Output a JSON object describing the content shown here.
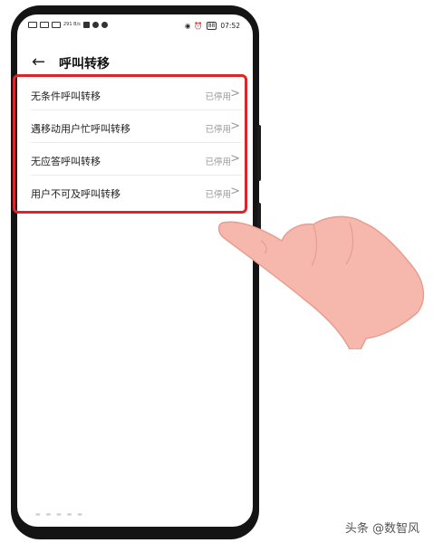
{
  "status_bar": {
    "carrier_info": "291 B/s",
    "battery": "88",
    "time": "07:52"
  },
  "header": {
    "back_label": "←",
    "title": "呼叫转移"
  },
  "items": [
    {
      "label": "无条件呼叫转移",
      "status": "已停用"
    },
    {
      "label": "遇移动用户忙呼叫转移",
      "status": "已停用"
    },
    {
      "label": "无应答呼叫转移",
      "status": "已停用"
    },
    {
      "label": "用户不可及呼叫转移",
      "status": "已停用"
    }
  ],
  "colors": {
    "highlight": "#d8262a",
    "hand": "#f6b8ac"
  },
  "icons": {
    "back": "arrow-left-icon",
    "chevron": "chevron-right-icon"
  },
  "watermark": "头条 @数智风"
}
